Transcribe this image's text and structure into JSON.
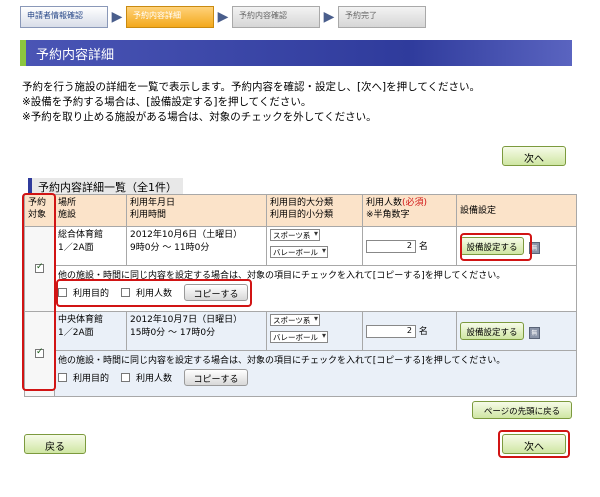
{
  "steps": [
    {
      "label": "申請者情報確認"
    },
    {
      "label": "予約内容詳細"
    },
    {
      "label": "予約内容確認"
    },
    {
      "label": "予約完了"
    }
  ],
  "page_title": "予約内容詳細",
  "intro": {
    "line1": "予約を行う施設の詳細を一覧で表示します。予約内容を確認・設定し、[次へ]を押してください。",
    "line2": "※設備を予約する場合は、[設備設定する]を押してください。",
    "line3": "※予約を取り止める施設がある場合は、対象のチェックを外してください。"
  },
  "next_label": "次へ",
  "back_label": "戻る",
  "page_top_label": "ページの先頭に戻る",
  "list_title": "予約内容詳細一覧（全1件）",
  "headers": {
    "target_1": "予約",
    "target_2": "対象",
    "place_1": "場所",
    "place_2": "施設",
    "date_1": "利用年月日",
    "date_2": "利用時間",
    "purpose_1": "利用目的大分類",
    "purpose_2": "利用目的小分類",
    "people_1": "利用人数",
    "people_required": "(必須)",
    "people_2": "※半角数字",
    "equipment": "設備設定"
  },
  "rows": [
    {
      "facility": "総合体育館",
      "room": "1／2A面",
      "date": "2012年10月6日（土曜日）",
      "time": "9時0分 ～ 11時0分",
      "purpose_major": "スポーツ系",
      "purpose_minor": "バレーボール",
      "people": "2",
      "unit": "名",
      "equip_label": "設備設定する",
      "mini_label": "無",
      "note": "他の施設・時間に同じ内容を設定する場合は、対象の項目にチェックを入れて[コピーする]を押してください。",
      "copy_purpose": "利用目的",
      "copy_people": "利用人数",
      "copy_label": "コピーする"
    },
    {
      "facility": "中央体育館",
      "room": "1／2A面",
      "date": "2012年10月7日（日曜日）",
      "time": "15時0分 ～ 17時0分",
      "purpose_major": "スポーツ系",
      "purpose_minor": "バレーボール",
      "people": "2",
      "unit": "名",
      "equip_label": "設備設定する",
      "mini_label": "無",
      "note": "他の施設・時間に同じ内容を設定する場合は、対象の項目にチェックを入れて[コピーする]を押してください。",
      "copy_purpose": "利用目的",
      "copy_people": "利用人数",
      "copy_label": "コピーする"
    }
  ],
  "colors": {
    "title_bar": "#2f3b9c",
    "accent_green": "#8cc63f",
    "highlight_red": "#d11414",
    "header_bg": "#fbe3c9"
  }
}
